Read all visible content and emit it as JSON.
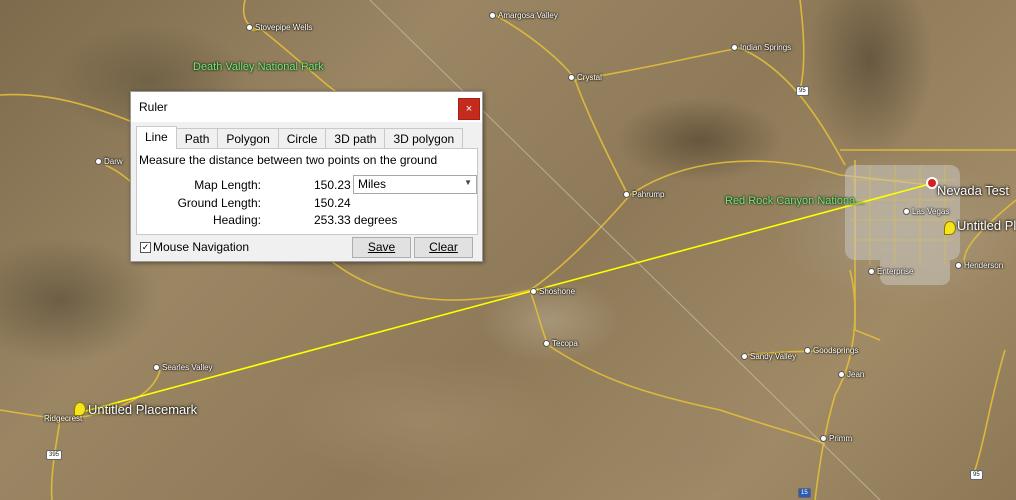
{
  "map": {
    "towns": [
      {
        "id": "stovepipe-wells",
        "label": "Stovepipe Wells"
      },
      {
        "id": "amargosa-valley",
        "label": "Amargosa Valley"
      },
      {
        "id": "indian-springs",
        "label": "Indian Springs"
      },
      {
        "id": "crystal",
        "label": "Crystal"
      },
      {
        "id": "darw",
        "label": "Darw"
      },
      {
        "id": "pahrump",
        "label": "Pahrump"
      },
      {
        "id": "las-vegas",
        "label": "Las Vegas"
      },
      {
        "id": "enterprise",
        "label": "Enterprise"
      },
      {
        "id": "henderson",
        "label": "Henderson"
      },
      {
        "id": "shoshone",
        "label": "Shoshone"
      },
      {
        "id": "tecopa",
        "label": "Tecopa"
      },
      {
        "id": "sandy-valley",
        "label": "Sandy Valley"
      },
      {
        "id": "goodsprings",
        "label": "Goodsprings"
      },
      {
        "id": "jean",
        "label": "Jean"
      },
      {
        "id": "primm",
        "label": "Primm"
      },
      {
        "id": "searles-valley",
        "label": "Searles Valley"
      },
      {
        "id": "ridgecrest",
        "label": "Ridgecrest"
      }
    ],
    "parks": {
      "death_valley": "Death Valley National Park",
      "red_rock": "Red Rock Canyon Nationa..."
    },
    "placemarks": {
      "west": "Untitled Placemark",
      "east": "Untitled Pl",
      "nevada": "Nevada Test"
    },
    "shields": {
      "i95_north": "95",
      "i395": "395",
      "i15": "15",
      "i95_south": "95"
    },
    "colors": {
      "ruler_line": "#ffff00",
      "roads": "#e8c440"
    }
  },
  "ruler": {
    "title": "Ruler",
    "close": "×",
    "tabs": [
      "Line",
      "Path",
      "Polygon",
      "Circle",
      "3D path",
      "3D polygon"
    ],
    "active_tab": "Line",
    "description": "Measure the distance between two points on the ground",
    "map_length_label": "Map Length:",
    "map_length_value": "150.23",
    "unit": "Miles",
    "ground_length_label": "Ground Length:",
    "ground_length_value": "150.24",
    "heading_label": "Heading:",
    "heading_value": "253.33 degrees",
    "mouse_nav_label": "Mouse Navigation",
    "mouse_nav_checked": true,
    "check_mark": "✓",
    "save": "Save",
    "clear": "Clear"
  }
}
